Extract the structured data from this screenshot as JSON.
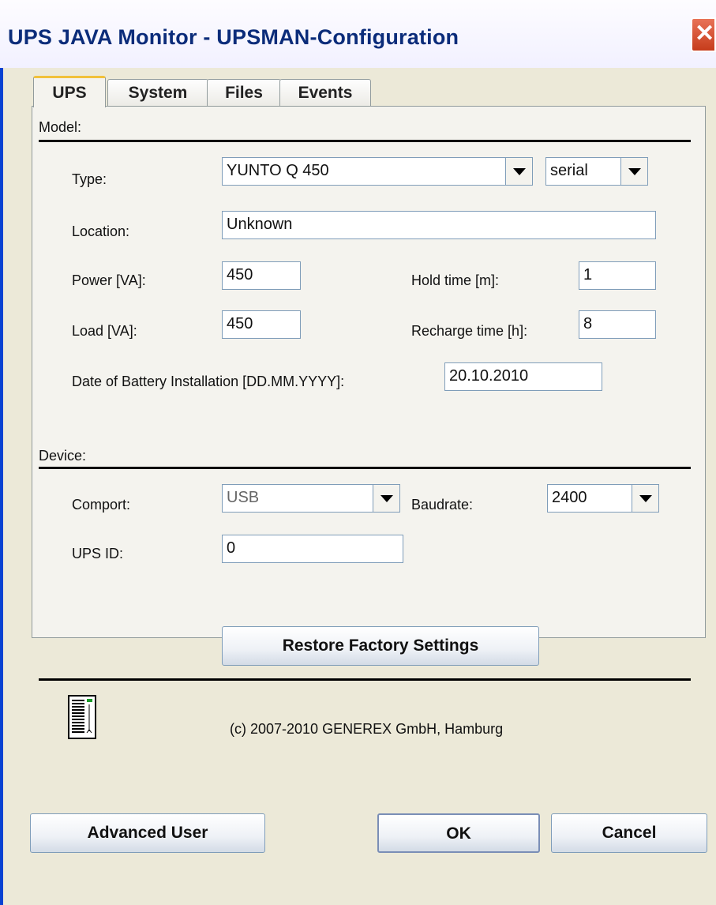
{
  "window": {
    "title": "UPS JAVA Monitor - UPSMAN-Configuration",
    "close_glyph": "✕"
  },
  "tabs": [
    {
      "label": "UPS",
      "active": true
    },
    {
      "label": "System",
      "active": false
    },
    {
      "label": "Files",
      "active": false
    },
    {
      "label": "Events",
      "active": false
    }
  ],
  "model": {
    "section_label": "Model:",
    "type_label": "Type:",
    "type_value": "YUNTO Q 450",
    "connection_value": "serial",
    "location_label": "Location:",
    "location_value": "Unknown",
    "power_label": "Power [VA]:",
    "power_value": "450",
    "hold_label": "Hold time [m]:",
    "hold_value": "1",
    "load_label": "Load [VA]:",
    "load_value": "450",
    "recharge_label": "Recharge time [h]:",
    "recharge_value": "8",
    "battery_label": "Date of Battery Installation [DD.MM.YYYY]:",
    "battery_value": "20.10.2010"
  },
  "device": {
    "section_label": "Device:",
    "comport_label": "Comport:",
    "comport_value": "USB",
    "baud_label": "Baudrate:",
    "baud_value": "2400",
    "upsid_label": "UPS ID:",
    "upsid_value": "0"
  },
  "restore_label": "Restore Factory Settings",
  "copyright": "(c) 2007-2010 GENEREX GmbH, Hamburg",
  "footer": {
    "advanced_label": "Advanced User",
    "ok_label": "OK",
    "cancel_label": "Cancel"
  },
  "colors": {
    "title_bar_border": "#0842D2",
    "close_button": "#D7532F",
    "active_tab_accent": "#F1C13B"
  }
}
